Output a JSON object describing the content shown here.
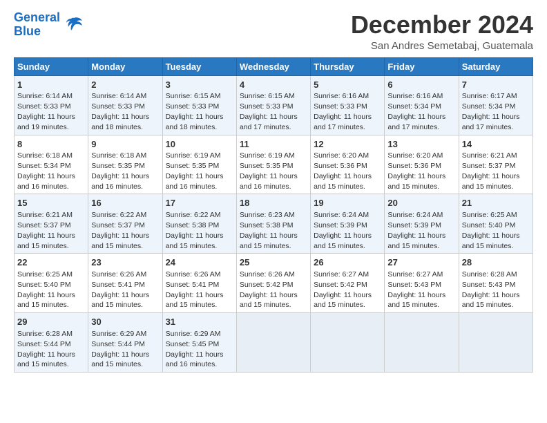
{
  "logo": {
    "line1": "General",
    "line2": "Blue"
  },
  "title": "December 2024",
  "subtitle": "San Andres Semetabaj, Guatemala",
  "headers": [
    "Sunday",
    "Monday",
    "Tuesday",
    "Wednesday",
    "Thursday",
    "Friday",
    "Saturday"
  ],
  "weeks": [
    [
      {
        "day": "1",
        "rise": "6:14 AM",
        "set": "5:33 PM",
        "daylight": "11 hours and 19 minutes."
      },
      {
        "day": "2",
        "rise": "6:14 AM",
        "set": "5:33 PM",
        "daylight": "11 hours and 18 minutes."
      },
      {
        "day": "3",
        "rise": "6:15 AM",
        "set": "5:33 PM",
        "daylight": "11 hours and 18 minutes."
      },
      {
        "day": "4",
        "rise": "6:15 AM",
        "set": "5:33 PM",
        "daylight": "11 hours and 17 minutes."
      },
      {
        "day": "5",
        "rise": "6:16 AM",
        "set": "5:33 PM",
        "daylight": "11 hours and 17 minutes."
      },
      {
        "day": "6",
        "rise": "6:16 AM",
        "set": "5:34 PM",
        "daylight": "11 hours and 17 minutes."
      },
      {
        "day": "7",
        "rise": "6:17 AM",
        "set": "5:34 PM",
        "daylight": "11 hours and 17 minutes."
      }
    ],
    [
      {
        "day": "8",
        "rise": "6:18 AM",
        "set": "5:34 PM",
        "daylight": "11 hours and 16 minutes."
      },
      {
        "day": "9",
        "rise": "6:18 AM",
        "set": "5:35 PM",
        "daylight": "11 hours and 16 minutes."
      },
      {
        "day": "10",
        "rise": "6:19 AM",
        "set": "5:35 PM",
        "daylight": "11 hours and 16 minutes."
      },
      {
        "day": "11",
        "rise": "6:19 AM",
        "set": "5:35 PM",
        "daylight": "11 hours and 16 minutes."
      },
      {
        "day": "12",
        "rise": "6:20 AM",
        "set": "5:36 PM",
        "daylight": "11 hours and 15 minutes."
      },
      {
        "day": "13",
        "rise": "6:20 AM",
        "set": "5:36 PM",
        "daylight": "11 hours and 15 minutes."
      },
      {
        "day": "14",
        "rise": "6:21 AM",
        "set": "5:37 PM",
        "daylight": "11 hours and 15 minutes."
      }
    ],
    [
      {
        "day": "15",
        "rise": "6:21 AM",
        "set": "5:37 PM",
        "daylight": "11 hours and 15 minutes."
      },
      {
        "day": "16",
        "rise": "6:22 AM",
        "set": "5:37 PM",
        "daylight": "11 hours and 15 minutes."
      },
      {
        "day": "17",
        "rise": "6:22 AM",
        "set": "5:38 PM",
        "daylight": "11 hours and 15 minutes."
      },
      {
        "day": "18",
        "rise": "6:23 AM",
        "set": "5:38 PM",
        "daylight": "11 hours and 15 minutes."
      },
      {
        "day": "19",
        "rise": "6:24 AM",
        "set": "5:39 PM",
        "daylight": "11 hours and 15 minutes."
      },
      {
        "day": "20",
        "rise": "6:24 AM",
        "set": "5:39 PM",
        "daylight": "11 hours and 15 minutes."
      },
      {
        "day": "21",
        "rise": "6:25 AM",
        "set": "5:40 PM",
        "daylight": "11 hours and 15 minutes."
      }
    ],
    [
      {
        "day": "22",
        "rise": "6:25 AM",
        "set": "5:40 PM",
        "daylight": "11 hours and 15 minutes."
      },
      {
        "day": "23",
        "rise": "6:26 AM",
        "set": "5:41 PM",
        "daylight": "11 hours and 15 minutes."
      },
      {
        "day": "24",
        "rise": "6:26 AM",
        "set": "5:41 PM",
        "daylight": "11 hours and 15 minutes."
      },
      {
        "day": "25",
        "rise": "6:26 AM",
        "set": "5:42 PM",
        "daylight": "11 hours and 15 minutes."
      },
      {
        "day": "26",
        "rise": "6:27 AM",
        "set": "5:42 PM",
        "daylight": "11 hours and 15 minutes."
      },
      {
        "day": "27",
        "rise": "6:27 AM",
        "set": "5:43 PM",
        "daylight": "11 hours and 15 minutes."
      },
      {
        "day": "28",
        "rise": "6:28 AM",
        "set": "5:43 PM",
        "daylight": "11 hours and 15 minutes."
      }
    ],
    [
      {
        "day": "29",
        "rise": "6:28 AM",
        "set": "5:44 PM",
        "daylight": "11 hours and 15 minutes."
      },
      {
        "day": "30",
        "rise": "6:29 AM",
        "set": "5:44 PM",
        "daylight": "11 hours and 15 minutes."
      },
      {
        "day": "31",
        "rise": "6:29 AM",
        "set": "5:45 PM",
        "daylight": "11 hours and 16 minutes."
      },
      null,
      null,
      null,
      null
    ]
  ]
}
